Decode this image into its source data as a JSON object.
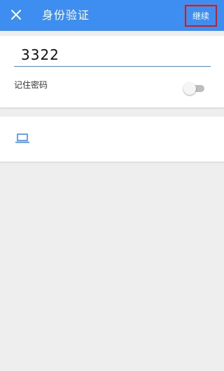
{
  "appbar": {
    "title": "身份验证",
    "continue_label": "继续",
    "close_icon": "close-icon"
  },
  "password": {
    "value": "3322"
  },
  "remember": {
    "label": "记住密码",
    "enabled": false
  },
  "device": {
    "icon": "laptop-icon"
  },
  "colors": {
    "primary": "#3d8ef0",
    "highlight_border": "#d11a1a",
    "background": "#eeeeee"
  }
}
